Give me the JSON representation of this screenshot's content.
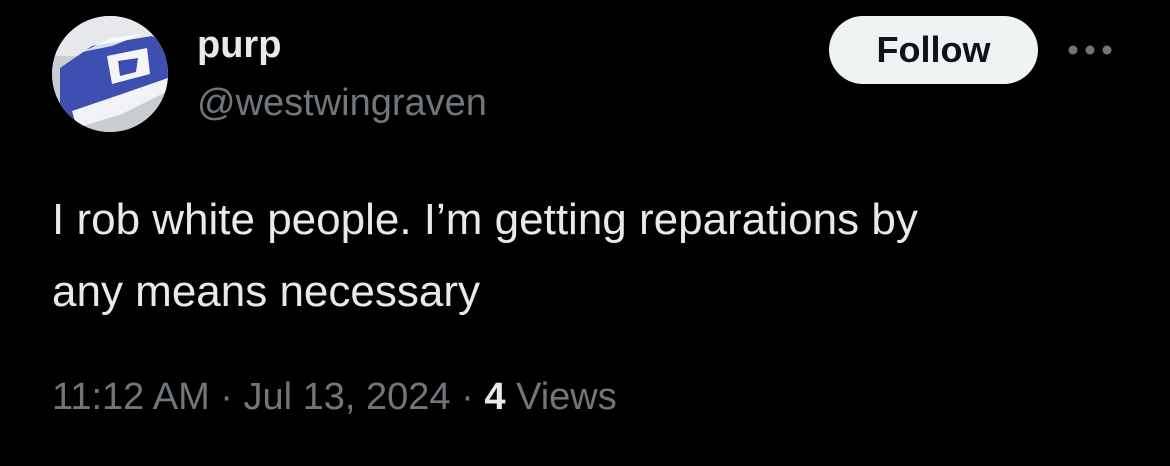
{
  "tweet": {
    "author": {
      "display_name": "purp",
      "handle": "@westwingraven"
    },
    "follow_label": "Follow",
    "more_icon": "more-horizontal-icon",
    "text": "I rob white people. I’m getting reparations by\nany means necessary",
    "meta": {
      "time": "11:12 AM",
      "separator": "·",
      "date": "Jul 13, 2024",
      "views_count": "4",
      "views_label": "Views"
    }
  },
  "colors": {
    "background": "#000000",
    "primary_text": "#e7e9ea",
    "secondary_text": "#71767b",
    "follow_bg": "#eff3f4",
    "follow_text": "#0f1419"
  }
}
